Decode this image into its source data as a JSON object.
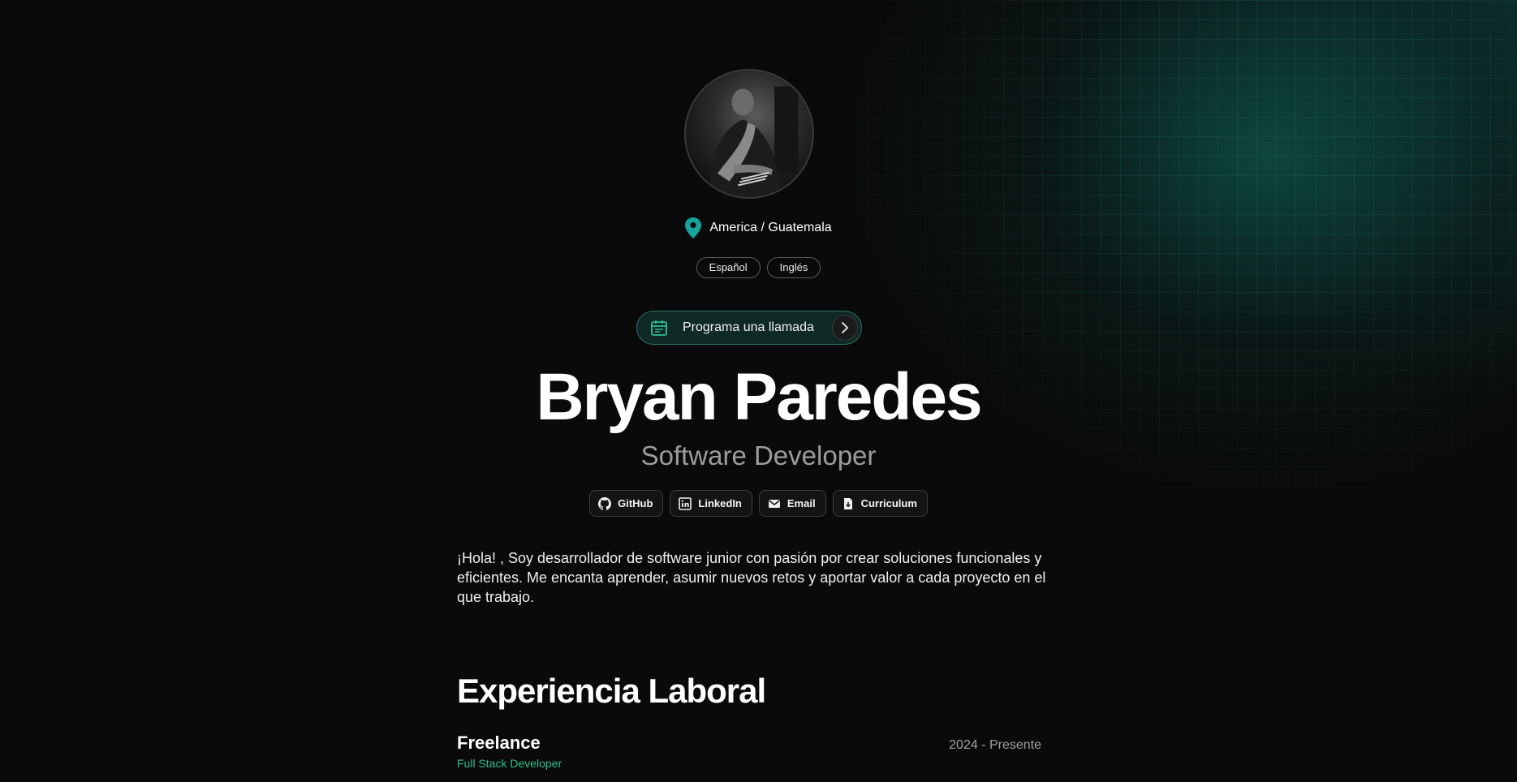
{
  "profile": {
    "location": "America / Guatemala",
    "languages": [
      "Español",
      "Inglés"
    ],
    "cta_label": "Programa una llamada",
    "name": "Bryan Paredes",
    "role": "Software Developer"
  },
  "socials": [
    {
      "label": "GitHub",
      "icon": "github-icon"
    },
    {
      "label": "LinkedIn",
      "icon": "linkedin-icon"
    },
    {
      "label": "Email",
      "icon": "mail-icon"
    },
    {
      "label": "Curriculum",
      "icon": "document-download-icon"
    }
  ],
  "about": "¡Hola! , Soy desarrollador de software junior con pasión por crear soluciones funcionales y eficientes. Me encanta aprender, asumir nuevos retos y aportar valor a cada proyecto en el que trabajo.",
  "experience": {
    "title": "Experiencia Laboral",
    "items": [
      {
        "company": "Freelance",
        "role": "Full Stack Developer",
        "period": "2024 - Presente"
      }
    ]
  },
  "colors": {
    "background": "#0a0a0a",
    "accent": "#2fbf8f",
    "pin": "#16a39a",
    "muted": "#9c9c9c"
  }
}
